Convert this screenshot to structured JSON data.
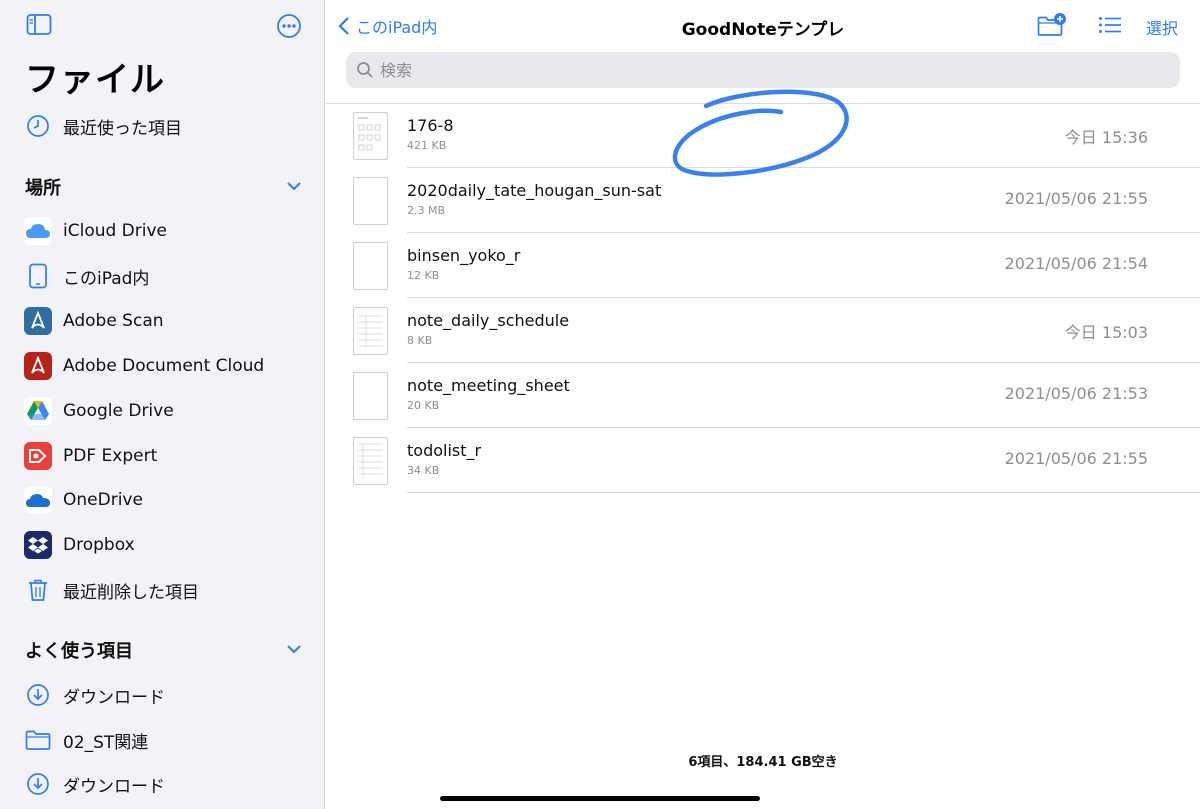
{
  "sidebar": {
    "title": "ファイル",
    "recent": "最近使った項目",
    "locations_header": "場所",
    "locations": [
      {
        "label": "iCloud Drive",
        "icon": "icloud-icon"
      },
      {
        "label": "このiPad内",
        "icon": "ipad-icon"
      },
      {
        "label": "Adobe Scan",
        "icon": "adobe-scan-icon"
      },
      {
        "label": "Adobe Document Cloud",
        "icon": "adobe-document-cloud-icon"
      },
      {
        "label": "Google Drive",
        "icon": "google-drive-icon"
      },
      {
        "label": "PDF Expert",
        "icon": "pdf-expert-icon"
      },
      {
        "label": "OneDrive",
        "icon": "onedrive-icon"
      },
      {
        "label": "Dropbox",
        "icon": "dropbox-icon"
      },
      {
        "label": "最近削除した項目",
        "icon": "trash-icon"
      }
    ],
    "favorites_header": "よく使う項目",
    "favorites": [
      {
        "label": "ダウンロード",
        "icon": "download-icon"
      },
      {
        "label": "02_ST関連",
        "icon": "folder-icon"
      },
      {
        "label": "ダウンロード",
        "icon": "download-icon"
      }
    ]
  },
  "header": {
    "back_label": "このiPad内",
    "title": "GoodNoteテンプレ",
    "select_label": "選択"
  },
  "search": {
    "placeholder": "検索"
  },
  "files": [
    {
      "name": "176-8",
      "size": "421 KB",
      "date": "今日 15:36"
    },
    {
      "name": "2020daily_tate_hougan_sun-sat",
      "size": "2.3 MB",
      "date": "2021/05/06 21:55"
    },
    {
      "name": "binsen_yoko_r",
      "size": "12 KB",
      "date": "2021/05/06 21:54"
    },
    {
      "name": "note_daily_schedule",
      "size": "8 KB",
      "date": "今日 15:03"
    },
    {
      "name": "note_meeting_sheet",
      "size": "20 KB",
      "date": "2021/05/06 21:53"
    },
    {
      "name": "todolist_r",
      "size": "34 KB",
      "date": "2021/05/06 21:55"
    }
  ],
  "footer": {
    "status": "6項目、184.41 GB空き"
  },
  "colors": {
    "accent": "#2f7cf6",
    "sidebar_bg": "#f2f2f7",
    "annotation": "#3a80f0"
  }
}
